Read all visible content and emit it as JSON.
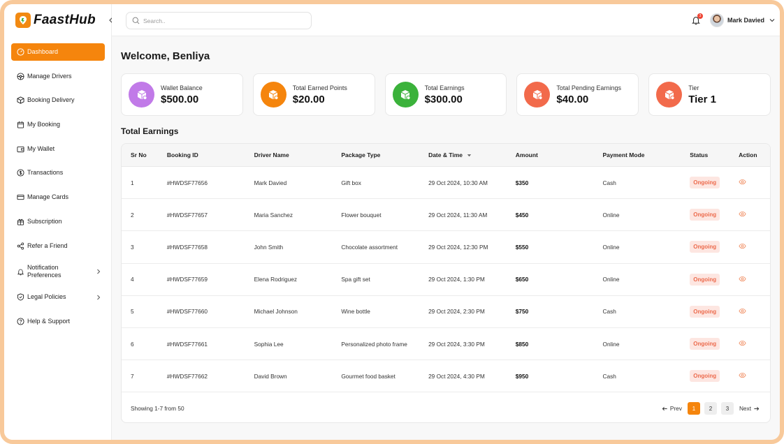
{
  "brand": {
    "name": "FaastHub"
  },
  "sidebar": {
    "items": [
      {
        "label": "Dashboard",
        "icon": "gauge-icon",
        "active": true
      },
      {
        "label": "Manage Drivers",
        "icon": "steering-wheel-icon"
      },
      {
        "label": "Booking Delivery",
        "icon": "box-icon"
      },
      {
        "label": "My Booking",
        "icon": "calendar-icon"
      },
      {
        "label": "My Wallet",
        "icon": "wallet-icon"
      },
      {
        "label": "Transactions",
        "icon": "dollar-icon"
      },
      {
        "label": "Manage Cards",
        "icon": "card-icon"
      },
      {
        "label": "Subscription",
        "icon": "gift-icon"
      },
      {
        "label": "Refer a Friend",
        "icon": "share-icon"
      },
      {
        "label": "Notification Preferences",
        "icon": "bell-icon",
        "chevron": true
      },
      {
        "label": "Legal Policies",
        "icon": "shield-icon",
        "chevron": true
      },
      {
        "label": "Help & Support",
        "icon": "help-icon"
      }
    ]
  },
  "topbar": {
    "search_placeholder": "Search..",
    "notification_count": "3",
    "user_name": "Mark Davied"
  },
  "main": {
    "welcome": "Welcome, Benliya",
    "section_title": "Total Earnings"
  },
  "stats": [
    {
      "label": "Wallet Balance",
      "value": "$500.00",
      "color": "#c17ae8"
    },
    {
      "label": "Total Earned Points",
      "value": "$20.00",
      "color": "#f5850d"
    },
    {
      "label": "Total Earnings",
      "value": "$300.00",
      "color": "#3bb23b"
    },
    {
      "label": "Total Pending Earnings",
      "value": "$40.00",
      "color": "#f26a4b"
    },
    {
      "label": "Tier",
      "value": "Tier 1",
      "color": "#f26a4b"
    }
  ],
  "table": {
    "columns": [
      "Sr No",
      "Booking ID",
      "Driver Name",
      "Package Type",
      "Date & Time",
      "Amount",
      "Payment Mode",
      "Status",
      "Action"
    ],
    "rows": [
      {
        "sr": "1",
        "id": "#HWDSF77656",
        "driver": "Mark Davied",
        "package": "Gift box",
        "datetime": "29 Oct 2024, 10:30 AM",
        "amount": "$350",
        "mode": "Cash",
        "status": "Ongoing"
      },
      {
        "sr": "2",
        "id": "#HWDSF77657",
        "driver": "Maria Sanchez",
        "package": "Flower bouquet",
        "datetime": "29 Oct 2024, 11:30 AM",
        "amount": "$450",
        "mode": "Online",
        "status": "Ongoing"
      },
      {
        "sr": "3",
        "id": "#HWDSF77658",
        "driver": "John Smith",
        "package": "Chocolate assortment",
        "datetime": "29 Oct 2024, 12:30 PM",
        "amount": "$550",
        "mode": "Online",
        "status": "Ongoing"
      },
      {
        "sr": "4",
        "id": "#HWDSF77659",
        "driver": "Elena Rodriguez",
        "package": "Spa gift set",
        "datetime": "29 Oct 2024, 1:30 PM",
        "amount": "$650",
        "mode": "Online",
        "status": "Ongoing"
      },
      {
        "sr": "5",
        "id": "#HWDSF77660",
        "driver": "Michael Johnson",
        "package": "Wine bottle",
        "datetime": "29 Oct 2024, 2:30 PM",
        "amount": "$750",
        "mode": "Cash",
        "status": "Ongoing"
      },
      {
        "sr": "6",
        "id": "#HWDSF77661",
        "driver": "Sophia Lee",
        "package": "Personalized photo frame",
        "datetime": "29 Oct 2024, 3:30 PM",
        "amount": "$850",
        "mode": "Online",
        "status": "Ongoing"
      },
      {
        "sr": "7",
        "id": "#HWDSF77662",
        "driver": "David Brown",
        "package": "Gourmet food basket",
        "datetime": "29 Oct 2024, 4:30 PM",
        "amount": "$950",
        "mode": "Cash",
        "status": "Ongoing"
      }
    ],
    "showing": "Showing 1-7 from 50",
    "pager": {
      "prev": "Prev",
      "next": "Next",
      "pages": [
        "1",
        "2",
        "3"
      ],
      "active_page": "1"
    }
  }
}
